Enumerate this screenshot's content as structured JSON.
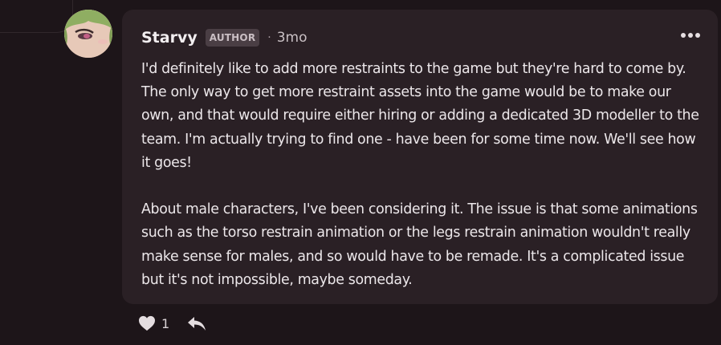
{
  "comment": {
    "author": "Starvy",
    "badge": "AUTHOR",
    "separator": "·",
    "timestamp": "3mo",
    "paragraphs": [
      "I'd definitely like to add more restraints to the game but they're hard to come by. The only way to get more restraint assets into the game would be to make our own, and that would require either hiring or adding a dedicated 3D modeller to the team. I'm actually trying to find one - have been for some time now. We'll see how it goes!",
      "About male characters, I've been considering it. The issue is that some animations such as the torso restrain animation or the legs restrain animation wouldn't really make sense for males, and so would have to be remade. It's a complicated issue but it's not impossible, maybe someday."
    ],
    "like_count": "1"
  },
  "icons": {
    "like": "heart-icon",
    "reply": "reply-arrow-icon",
    "more": "more-options-icon"
  },
  "colors": {
    "background": "#1d1519",
    "card": "#2a2025",
    "badge_bg": "#4a3e44",
    "text": "#ece7ea"
  }
}
